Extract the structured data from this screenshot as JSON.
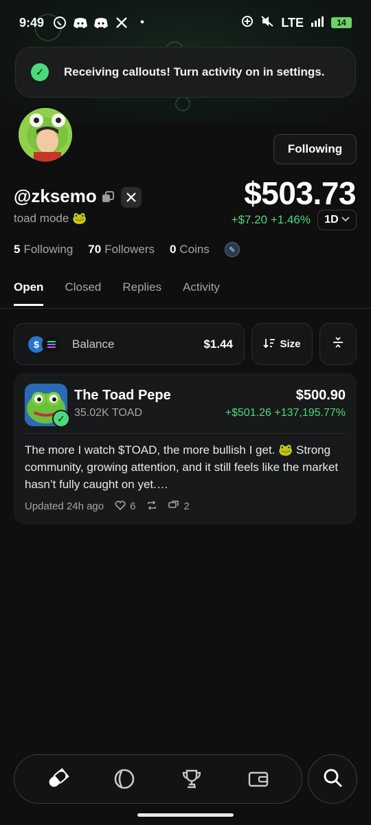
{
  "status_bar": {
    "time": "9:49",
    "network": "LTE",
    "battery": "14"
  },
  "toast": {
    "message": "Receiving callouts! Turn activity on in settings."
  },
  "profile": {
    "handle": "@zksemo",
    "bio": "toad mode 🐸",
    "follow_button": "Following",
    "portfolio_value": "$503.73",
    "change": "+$7.20 +1.46%",
    "period": "1D",
    "following_count": "5",
    "following_label": "Following",
    "followers_count": "70",
    "followers_label": "Followers",
    "coins_count": "0",
    "coins_label": "Coins"
  },
  "tabs": [
    "Open",
    "Closed",
    "Replies",
    "Activity"
  ],
  "balance": {
    "label": "Balance",
    "amount": "$1.44"
  },
  "sort": {
    "label": "Size"
  },
  "position": {
    "name": "The Toad Pepe",
    "quantity": "35.02K TOAD",
    "value": "$500.90",
    "gain": "+$501.26 +137,195.77%",
    "post_text": "The more I watch $TOAD, the more bullish I get. 🐸 Strong community, growing attention, and it still feels like the market hasn’t fully caught on yet.…",
    "updated": "Updated 24h ago",
    "likes": "6",
    "comments": "2"
  },
  "colors": {
    "accent_green": "#4cd97b",
    "background": "#0f0f10"
  }
}
